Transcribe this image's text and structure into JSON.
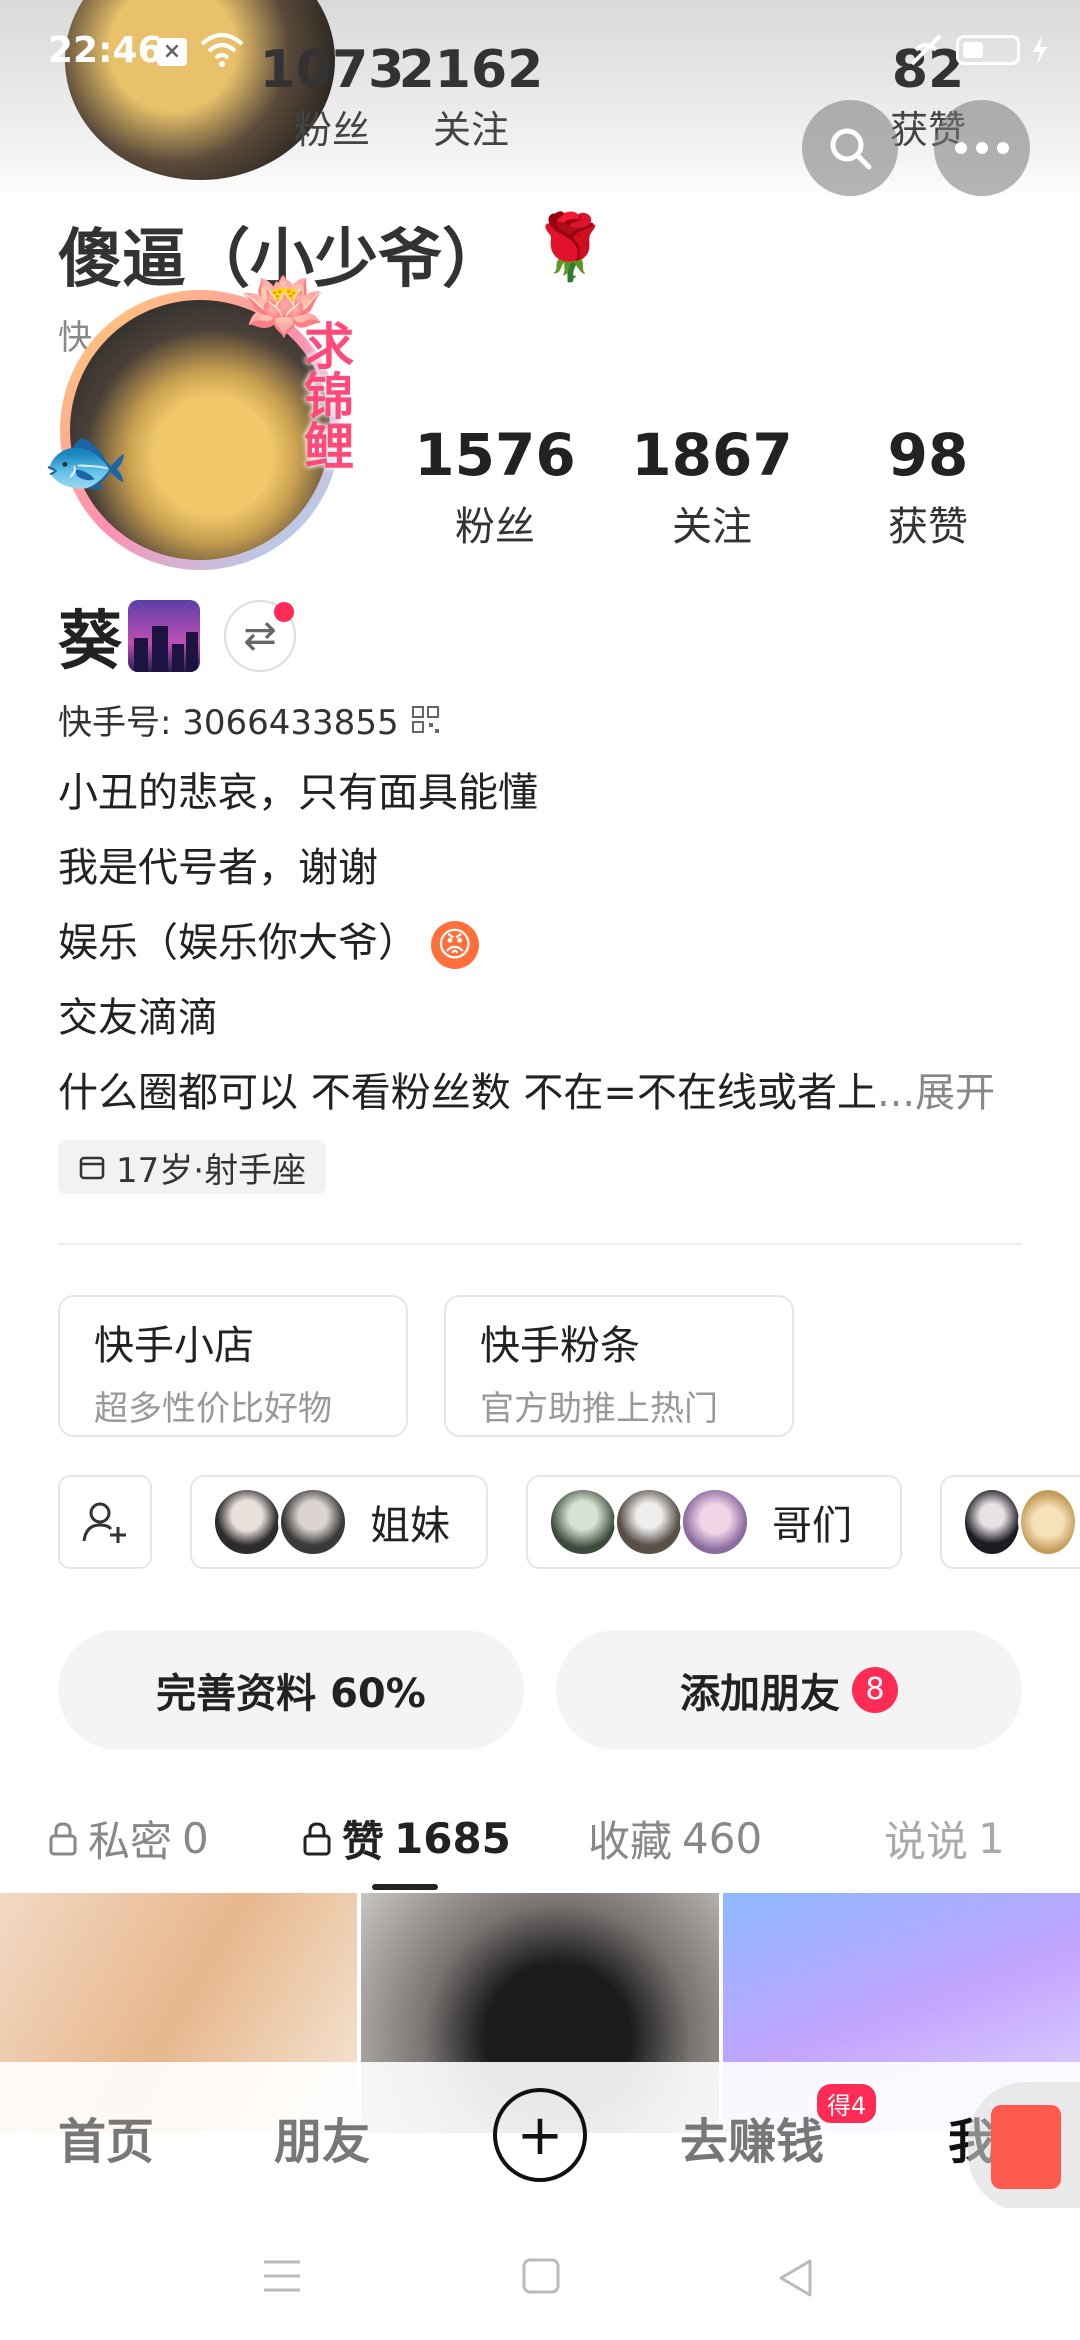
{
  "status_bar": {
    "time": "22:46",
    "notif_glyph": "×"
  },
  "ghost_header": {
    "stats": [
      {
        "num": "1073",
        "label": "粉丝"
      },
      {
        "num": "2162",
        "label": "关注"
      },
      {
        "num": "82",
        "label": "获赞"
      }
    ],
    "name": "傻逼（小少爷）",
    "id_partial": "快…63"
  },
  "profile": {
    "badge_text": "求锦鲤",
    "stats": [
      {
        "num": "1576",
        "label": "粉丝"
      },
      {
        "num": "1867",
        "label": "关注"
      },
      {
        "num": "98",
        "label": "获赞"
      }
    ],
    "name": "葵",
    "switch_glyph": "⇄",
    "kuaishou_id": "快手号: 3066433855",
    "bio": [
      "小丑的悲哀，只有面具能懂",
      "我是代号者，谢谢",
      "娱乐（娱乐你大爷）",
      "交友滴滴",
      "什么圈都可以 不看粉丝数 不在=不在线或者上"
    ],
    "angry_emoji": "😡",
    "bio_more": "...展开",
    "tag": "17岁·射手座"
  },
  "cards": [
    {
      "title": "快手小店",
      "subtitle": "超多性价比好物"
    },
    {
      "title": "快手粉条",
      "subtitle": "官方助推上热门"
    }
  ],
  "groups": [
    {
      "name": "姐妹"
    },
    {
      "name": "哥们"
    }
  ],
  "actions": {
    "complete_profile": "完善资料 60%",
    "add_friends": "添加朋友",
    "add_friends_count": "8"
  },
  "tabs": [
    {
      "label": "私密",
      "count": "0"
    },
    {
      "label": "赞",
      "count": "1685"
    },
    {
      "label": "收藏",
      "count": "460"
    },
    {
      "label": "说说",
      "count": "1"
    }
  ],
  "bottom_nav": {
    "home": "首页",
    "friends": "朋友",
    "plus": "+",
    "earn": "去赚钱",
    "earn_badge": "得4",
    "me": "我"
  },
  "colors": {
    "accent": "#fe2c55",
    "text": "#222222",
    "muted": "#888888"
  }
}
